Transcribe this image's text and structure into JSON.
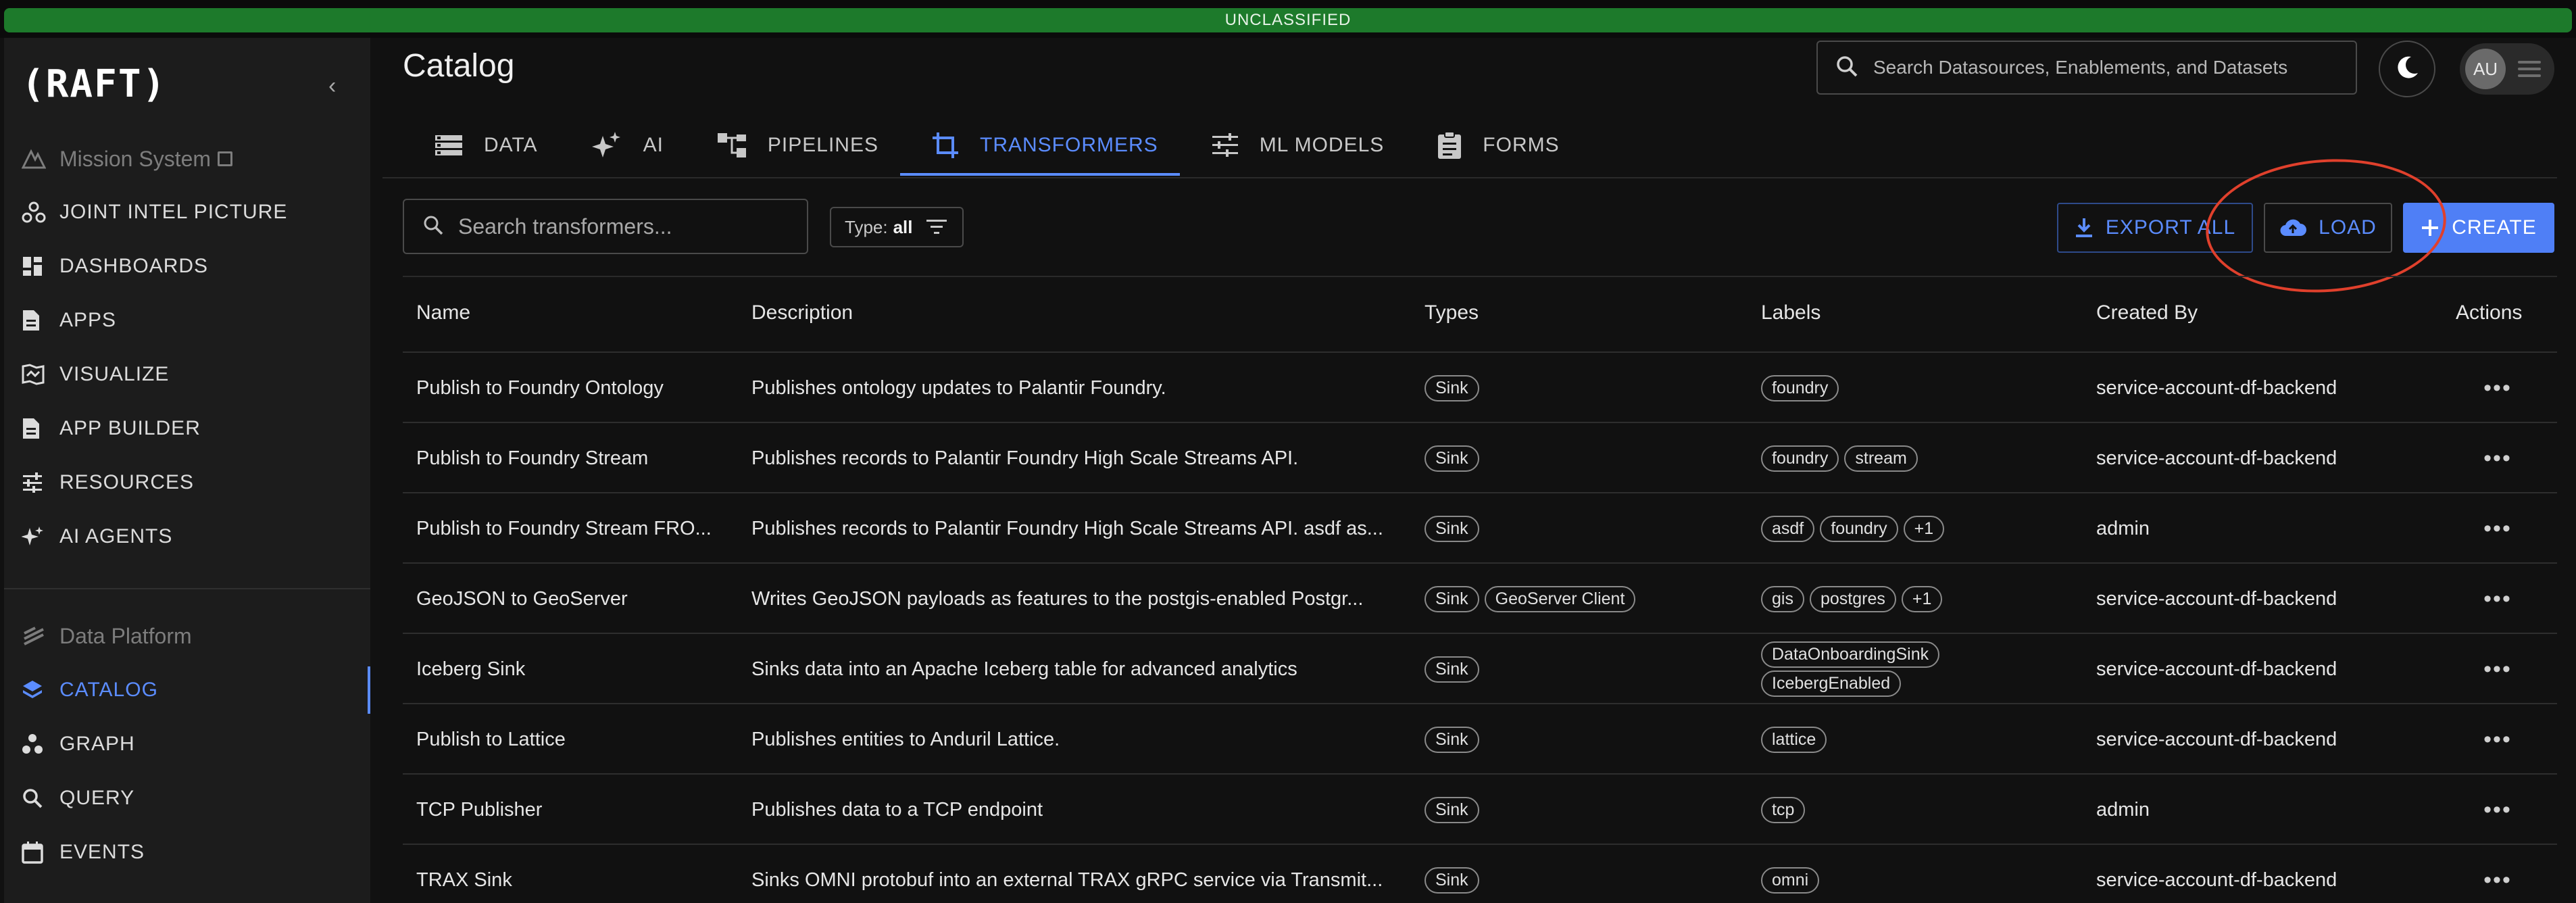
{
  "banner": {
    "text": "UNCLASSIFIED"
  },
  "sidebar": {
    "logo": "(RAFT)",
    "items": [
      {
        "label": "Mission System",
        "icon": "mission-system-icon",
        "section": true
      },
      {
        "label": "JOINT INTEL PICTURE",
        "icon": "joint-intel-icon"
      },
      {
        "label": "DASHBOARDS",
        "icon": "dashboards-icon"
      },
      {
        "label": "APPS",
        "icon": "apps-icon"
      },
      {
        "label": "VISUALIZE",
        "icon": "visualize-icon"
      },
      {
        "label": "APP BUILDER",
        "icon": "app-builder-icon"
      },
      {
        "label": "RESOURCES",
        "icon": "resources-icon"
      },
      {
        "label": "AI AGENTS",
        "icon": "ai-agents-icon"
      },
      {
        "label": "Data Platform",
        "icon": "data-platform-icon",
        "section": true
      },
      {
        "label": "CATALOG",
        "icon": "catalog-layers-icon",
        "active": true
      },
      {
        "label": "GRAPH",
        "icon": "graph-icon"
      },
      {
        "label": "QUERY",
        "icon": "query-search-icon"
      },
      {
        "label": "EVENTS",
        "icon": "events-calendar-icon"
      }
    ]
  },
  "header": {
    "title": "Catalog",
    "search_placeholder": "Search Datasources, Enablements, and Datasets",
    "user_initials": "AU"
  },
  "tabs": [
    {
      "label": "DATA",
      "icon": "data-list-icon"
    },
    {
      "label": "AI",
      "icon": "ai-sparkle-icon"
    },
    {
      "label": "PIPELINES",
      "icon": "pipelines-icon"
    },
    {
      "label": "TRANSFORMERS",
      "icon": "transformers-crop-icon",
      "active": true
    },
    {
      "label": "ML MODELS",
      "icon": "ml-models-tune-icon"
    },
    {
      "label": "FORMS",
      "icon": "forms-clipboard-icon"
    }
  ],
  "toolbar": {
    "search_placeholder": "Search transformers...",
    "type_label": "Type:",
    "type_value": "all",
    "export_label": "EXPORT ALL",
    "load_label": "LOAD",
    "create_label": "CREATE"
  },
  "table": {
    "headers": [
      "Name",
      "Description",
      "Types",
      "Labels",
      "Created By",
      "Actions"
    ],
    "rows": [
      {
        "name": "Publish to Foundry Ontology",
        "description": "Publishes ontology updates to Palantir Foundry.",
        "types": [
          "Sink"
        ],
        "labels": [
          "foundry"
        ],
        "created_by": "service-account-df-backend"
      },
      {
        "name": "Publish to Foundry Stream",
        "description": "Publishes records to Palantir Foundry High Scale Streams API.",
        "types": [
          "Sink"
        ],
        "labels": [
          "foundry",
          "stream"
        ],
        "created_by": "service-account-df-backend"
      },
      {
        "name": "Publish to Foundry Stream FRO...",
        "description": "Publishes records to Palantir Foundry High Scale Streams API. asdf as...",
        "types": [
          "Sink"
        ],
        "labels": [
          "asdf",
          "foundry",
          "+1"
        ],
        "created_by": "admin"
      },
      {
        "name": "GeoJSON to GeoServer",
        "description": "Writes GeoJSON payloads as features to the postgis-enabled Postgr...",
        "types": [
          "Sink",
          "GeoServer Client"
        ],
        "labels": [
          "gis",
          "postgres",
          "+1"
        ],
        "created_by": "service-account-df-backend"
      },
      {
        "name": "Iceberg Sink",
        "description": "Sinks data into an Apache Iceberg table for advanced analytics",
        "types": [
          "Sink"
        ],
        "labels": [
          "DataOnboardingSink",
          "IcebergEnabled"
        ],
        "created_by": "service-account-df-backend"
      },
      {
        "name": "Publish to Lattice",
        "description": "Publishes entities to Anduril Lattice.",
        "types": [
          "Sink"
        ],
        "labels": [
          "lattice"
        ],
        "created_by": "service-account-df-backend"
      },
      {
        "name": "TCP Publisher",
        "description": "Publishes data to a TCP endpoint",
        "types": [
          "Sink"
        ],
        "labels": [
          "tcp"
        ],
        "created_by": "admin"
      },
      {
        "name": "TRAX Sink",
        "description": "Sinks OMNI protobuf into an external TRAX gRPC service via Transmit...",
        "types": [
          "Sink"
        ],
        "labels": [
          "omni"
        ],
        "created_by": "service-account-df-backend"
      }
    ],
    "action_glyph": "•••"
  },
  "colors": {
    "accent": "#5b8cff",
    "banner": "#1d7a2b",
    "annotation": "#e0402c"
  }
}
